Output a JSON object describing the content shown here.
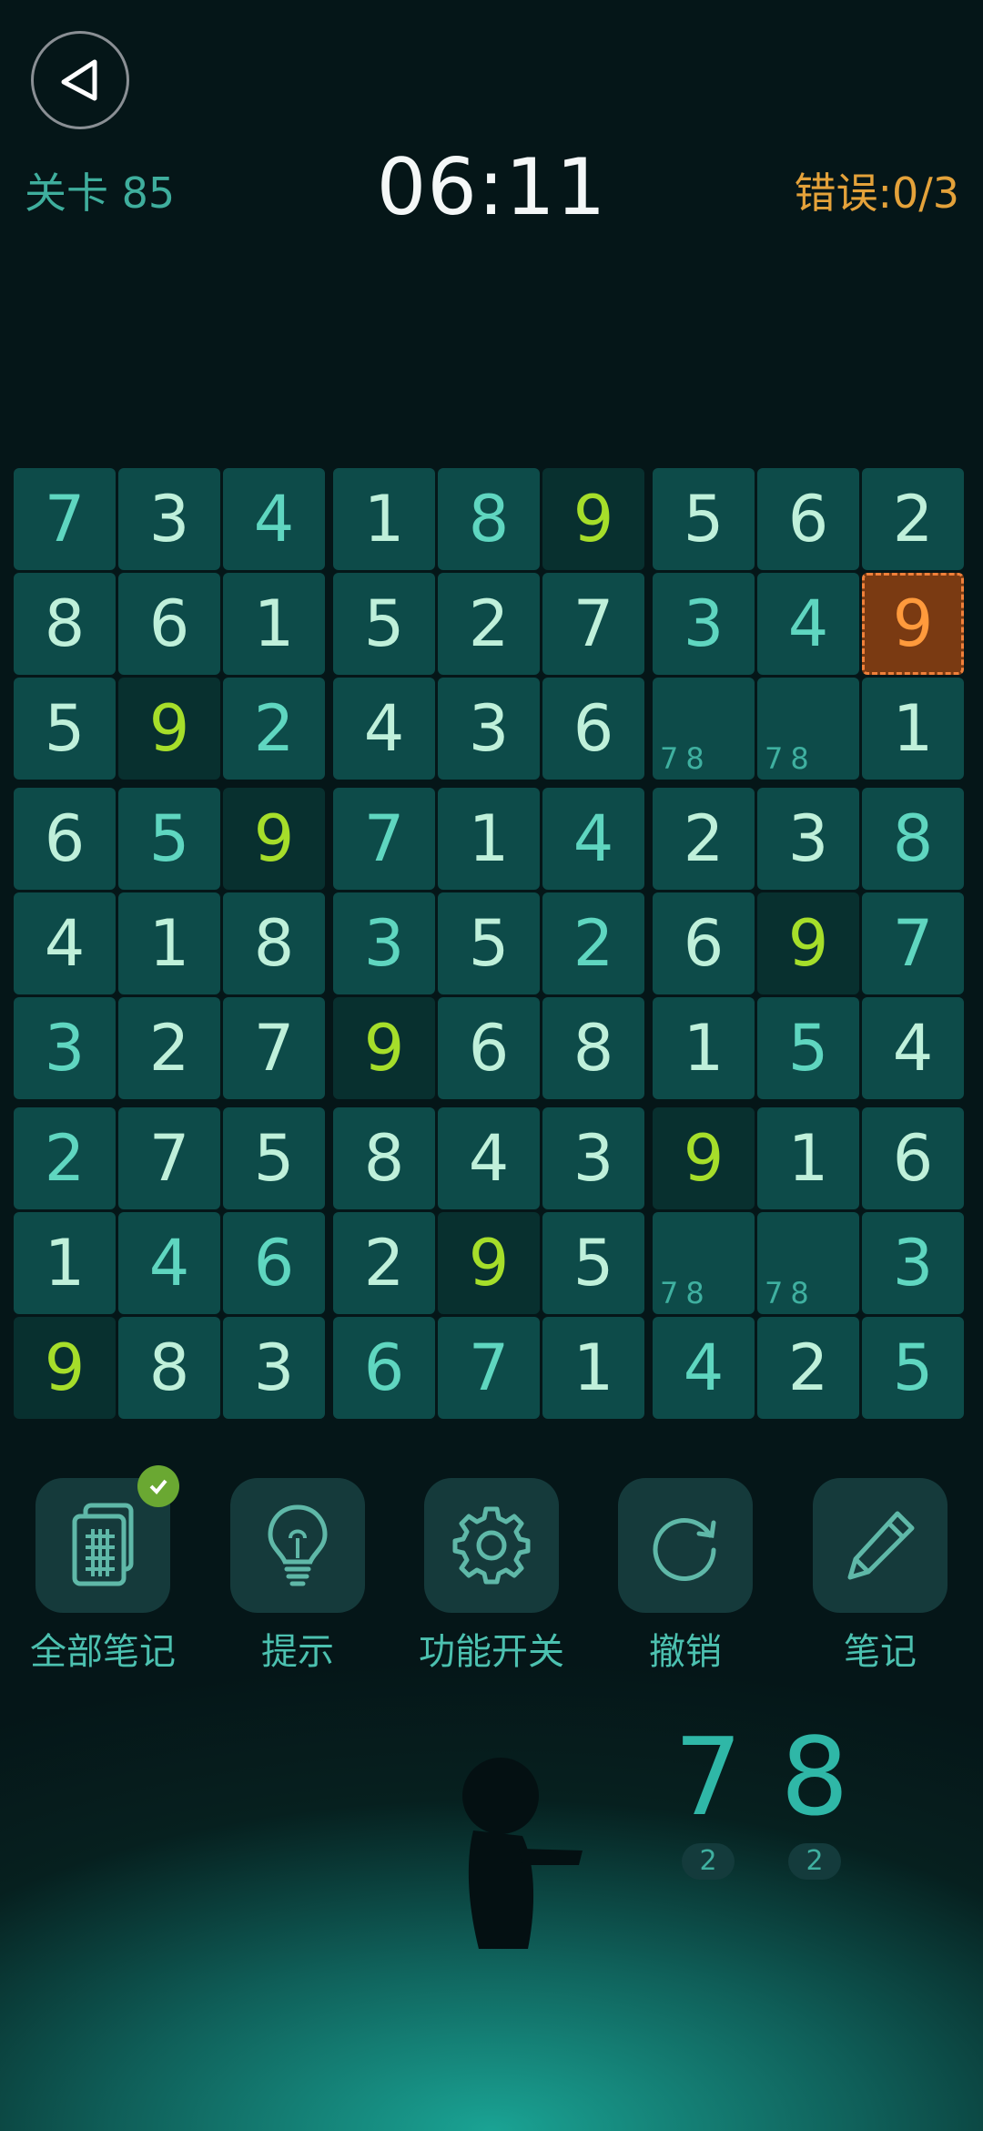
{
  "header": {
    "level": "关卡 85",
    "timer": "06:11",
    "errors": "错误:0/3"
  },
  "board": {
    "rows": [
      [
        "7",
        "3",
        "4",
        "1",
        "8",
        "9",
        "5",
        "6",
        "2"
      ],
      [
        "8",
        "6",
        "1",
        "5",
        "2",
        "7",
        "3",
        "4",
        "9"
      ],
      [
        "5",
        "9",
        "2",
        "4",
        "3",
        "6",
        "",
        "",
        "1"
      ],
      [
        "6",
        "5",
        "9",
        "7",
        "1",
        "4",
        "2",
        "3",
        "8"
      ],
      [
        "4",
        "1",
        "8",
        "3",
        "5",
        "2",
        "6",
        "9",
        "7"
      ],
      [
        "3",
        "2",
        "7",
        "9",
        "6",
        "8",
        "1",
        "5",
        "4"
      ],
      [
        "2",
        "7",
        "5",
        "8",
        "4",
        "3",
        "9",
        "1",
        "6"
      ],
      [
        "1",
        "4",
        "6",
        "2",
        "9",
        "5",
        "",
        "",
        "3"
      ],
      [
        "9",
        "8",
        "3",
        "6",
        "7",
        "1",
        "4",
        "2",
        "5"
      ]
    ],
    "notes": {
      "2-6": "78",
      "2-7": "78",
      "7-6": "78",
      "7-7": "78"
    },
    "selected": "1-8",
    "colors": {
      "bright": "#bff0da",
      "mid": "#5fd6c0",
      "highlight": "#a6de2a",
      "selected": "#ff9a3c"
    }
  },
  "toolbar": [
    {
      "label": "全部笔记",
      "icon": "all-notes-icon",
      "checked": true
    },
    {
      "label": "提示",
      "icon": "lightbulb-icon"
    },
    {
      "label": "功能开关",
      "icon": "gear-icon"
    },
    {
      "label": "撤销",
      "icon": "undo-icon"
    },
    {
      "label": "笔记",
      "icon": "pencil-icon"
    }
  ],
  "remaining": [
    {
      "digit": "7",
      "count": "2"
    },
    {
      "digit": "8",
      "count": "2"
    }
  ]
}
